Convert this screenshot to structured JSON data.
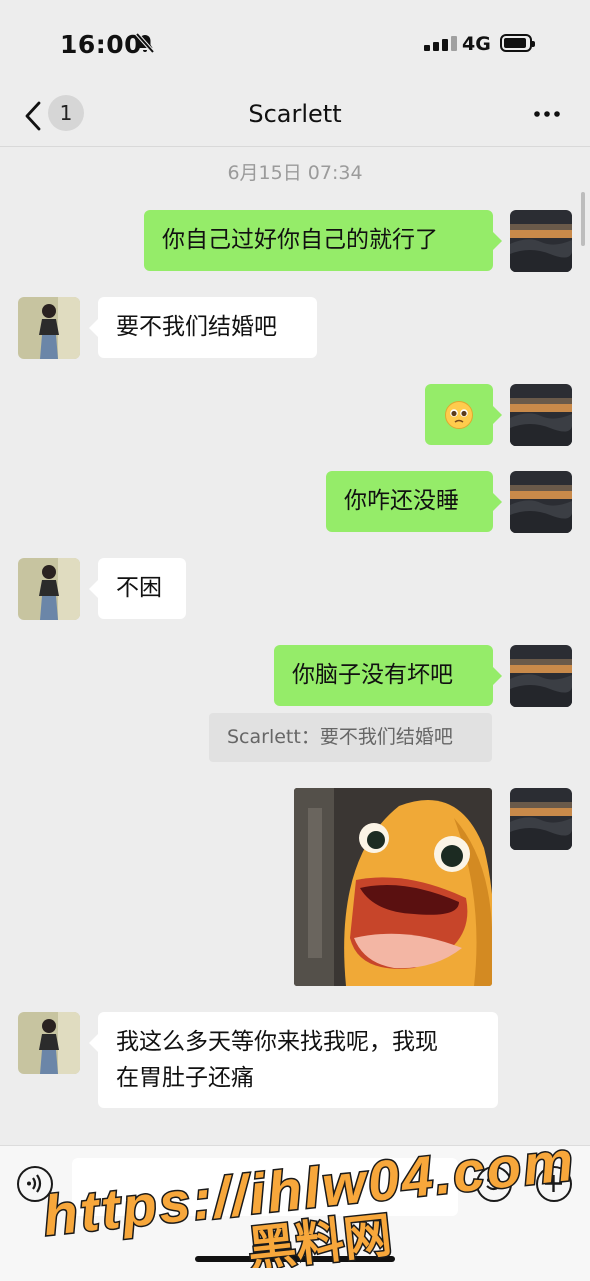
{
  "status_bar": {
    "time": "16:00",
    "network": "4G"
  },
  "nav": {
    "back_count": "1",
    "title": "Scarlett"
  },
  "timestamp": "6月15日 07:34",
  "messages": [
    {
      "sender": "me",
      "type": "text",
      "text": "你自己过好你自己的就行了"
    },
    {
      "sender": "Scarlett",
      "type": "text",
      "text": "要不我们结婚吧"
    },
    {
      "sender": "me",
      "type": "emoji",
      "emoji": "pleading-face"
    },
    {
      "sender": "me",
      "type": "text",
      "text": "你咋还没睡"
    },
    {
      "sender": "Scarlett",
      "type": "text",
      "text": "不困"
    },
    {
      "sender": "me",
      "type": "text",
      "text": "你脑子没有坏吧",
      "quote": "Scarlett：要不我们结婚吧"
    },
    {
      "sender": "me",
      "type": "sticker",
      "sticker": "shocked-yellow-creature"
    },
    {
      "sender": "Scarlett",
      "type": "text",
      "text_line1": "我这么多天等你来找我呢，我现",
      "text_line2": "在胃肚子还痛"
    }
  ],
  "watermark": {
    "line1": "https://ihlw04.com",
    "line2": "黑料网"
  },
  "colors": {
    "my_bubble": "#95ec69",
    "her_bubble": "#ffffff",
    "background": "#ededed",
    "watermark_fill": "#f7a73b"
  },
  "icons": [
    "mute-bell-icon",
    "signal-icon",
    "battery-icon",
    "back-chevron-icon",
    "more-icon",
    "voice-icon",
    "emoji-icon",
    "plus-icon"
  ]
}
